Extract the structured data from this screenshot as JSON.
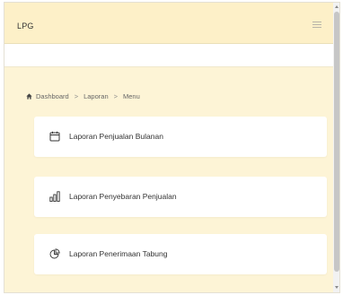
{
  "header": {
    "title": "LPG"
  },
  "breadcrumb": {
    "items": [
      "Dashboard",
      "Laporan",
      "Menu"
    ],
    "separator": ">"
  },
  "menu": {
    "items": [
      {
        "label": "Laporan Penjualan Bulanan",
        "icon": "calendar-icon"
      },
      {
        "label": "Laporan Penyebaran Penjualan",
        "icon": "bar-chart-icon"
      },
      {
        "label": "Laporan Penerimaan Tabung",
        "icon": "pie-chart-icon"
      }
    ]
  },
  "colors": {
    "background": "#fdf4d6",
    "topbar": "#fdf0c8",
    "card": "#ffffff"
  }
}
